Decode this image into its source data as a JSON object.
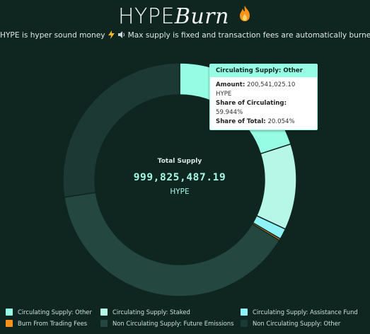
{
  "header": {
    "title_main": "HYPE",
    "title_accent": "Burn",
    "flame_icon": "fire-icon",
    "subtitle_text": "HYPE is hyper sound money",
    "subtitle_icons": [
      "lightning-icon",
      "speaker-icon"
    ],
    "subtitle_rest": "Max supply is fixed and transaction fees are automatically burned."
  },
  "center": {
    "label": "Total Supply",
    "value": "999,825,487.19",
    "unit": "HYPE"
  },
  "tooltip": {
    "title": "Circulating Supply: Other",
    "rows": [
      {
        "key": "Amount:",
        "val": "200,541,025.10 HYPE"
      },
      {
        "key": "Share of Circulating:",
        "val": "59.944%"
      },
      {
        "key": "Share of Total:",
        "val": "20.054%"
      }
    ]
  },
  "chart_data": {
    "type": "pie",
    "donut": true,
    "series": [
      {
        "name": "Circulating Supply: Other",
        "value": 20.054,
        "color": "#97fce4"
      },
      {
        "name": "Circulating Supply: Staked",
        "value": 11.9,
        "color": "#b6f7e8"
      },
      {
        "name": "Circulating Supply: Assistance Fund",
        "value": 1.5,
        "color": "#8ef2f6"
      },
      {
        "name": "Burn From Trading Fees",
        "value": 0.25,
        "color": "#f7931a"
      },
      {
        "name": "Non Circulating Supply: Future Emissions",
        "value": 38.9,
        "color": "#24473f"
      },
      {
        "name": "Non Circulating Supply: Other",
        "value": 27.4,
        "color": "#1c3933"
      }
    ],
    "start_angle_deg": 0,
    "direction": "clockwise",
    "legend_position": "bottom"
  },
  "colors": {
    "background": "#0f2620",
    "accent": "#97fce4",
    "center_value": "#a5f7e5",
    "flame": "#f7931a"
  }
}
